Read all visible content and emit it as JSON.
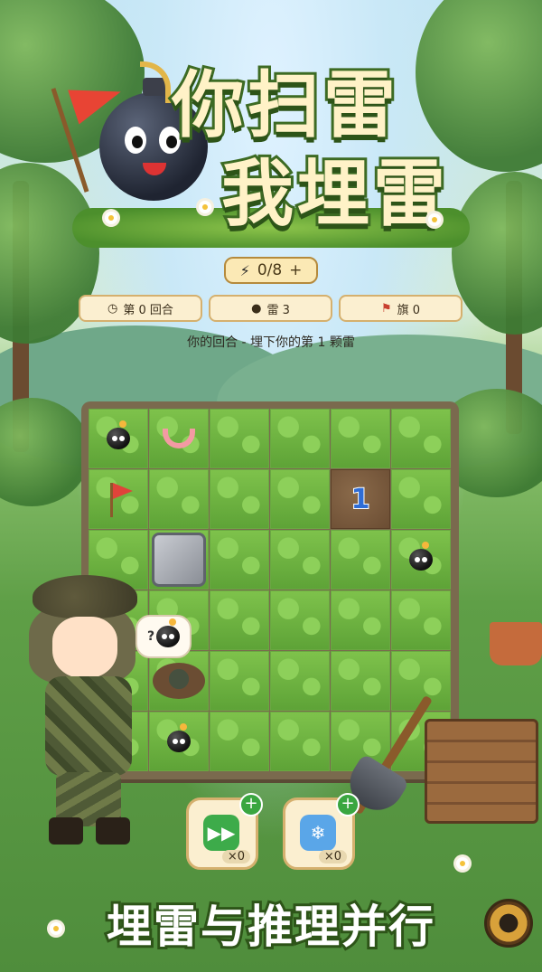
{
  "title": {
    "line1": "你扫雷",
    "line2": "我埋雷"
  },
  "energy": {
    "icon": "lightning-icon",
    "value": "0/8",
    "plus": "+"
  },
  "stats": {
    "round": {
      "icon": "clock-icon",
      "label": "第 0 回合"
    },
    "mines": {
      "icon": "bomb-icon",
      "label": "雷 3"
    },
    "flags": {
      "icon": "flag-icon",
      "label": "旗 0"
    }
  },
  "status_text": "你的回合 - 埋下你的第 1 颗雷",
  "board": {
    "size": 6,
    "cells": [
      [
        "bomb",
        "worm",
        "",
        "",
        "",
        ""
      ],
      [
        "flag",
        "",
        "",
        "",
        "dirt:1",
        ""
      ],
      [
        "",
        "stone",
        "",
        "",
        "",
        "bomb"
      ],
      [
        "",
        "",
        "",
        "",
        "",
        ""
      ],
      [
        "",
        "mound",
        "",
        "",
        "",
        ""
      ],
      [
        "",
        "bomb",
        "",
        "",
        "",
        ""
      ]
    ]
  },
  "speech_bubble": {
    "text": "?",
    "icon": "bomb-icon"
  },
  "items": [
    {
      "name": "skip-turn",
      "icon": "fast-forward-icon",
      "glyph": "▶▶",
      "plus": "+",
      "count": "×0"
    },
    {
      "name": "freeze",
      "icon": "snowflake-icon",
      "glyph": "❄",
      "plus": "+",
      "count": "×0"
    }
  ],
  "tagline": "埋雷与推理并行",
  "settings": {
    "icon": "gear-icon"
  },
  "colors": {
    "number_blue": "#2f6dd6",
    "chip_bg": "#fbefd0",
    "title_fill": "#fff2c7",
    "title_stroke": "#3d6b23"
  }
}
